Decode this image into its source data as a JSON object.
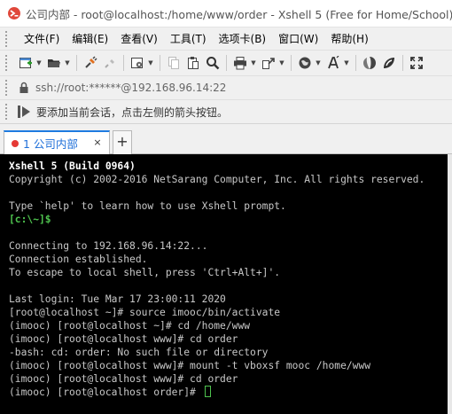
{
  "window": {
    "title": "公司内部 - root@localhost:/home/www/order - Xshell 5 (Free for Home/School)"
  },
  "menu": {
    "items": [
      "文件(F)",
      "编辑(E)",
      "查看(V)",
      "工具(T)",
      "选项卡(B)",
      "窗口(W)",
      "帮助(H)"
    ]
  },
  "toolbar": {
    "icons": [
      "new-session-icon",
      "open-folder-icon",
      "connect-icon",
      "disconnect-icon",
      "properties-icon",
      "copy-icon",
      "paste-icon",
      "find-icon",
      "print-icon",
      "transfer-icon",
      "globe-icon",
      "font-icon",
      "xftp-icon",
      "xshell-icon",
      "fullscreen-icon"
    ]
  },
  "address": {
    "value": "ssh://root:******@192.168.96.14:22"
  },
  "hint": {
    "text": "要添加当前会话，点击左侧的箭头按钮。"
  },
  "tabs": {
    "active_label": "1 公司内部",
    "close_glyph": "×",
    "new_glyph": "+"
  },
  "terminal": {
    "lines": [
      "Xshell 5 (Build 0964)",
      "Copyright (c) 2002-2016 NetSarang Computer, Inc. All rights reserved.",
      "",
      "Type `help' to learn how to use Xshell prompt.",
      "[c:\\~]$",
      "",
      "Connecting to 192.168.96.14:22...",
      "Connection established.",
      "To escape to local shell, press 'Ctrl+Alt+]'.",
      "",
      "Last login: Tue Mar 17 23:00:11 2020",
      "[root@localhost ~]# source imooc/bin/activate",
      "(imooc) [root@localhost ~]# cd /home/www",
      "(imooc) [root@localhost www]# cd order",
      "-bash: cd: order: No such file or directory",
      "(imooc) [root@localhost www]# mount -t vboxsf mooc /home/www",
      "(imooc) [root@localhost www]# cd order",
      "(imooc) [root@localhost order]# "
    ],
    "bold_lines": [
      0
    ],
    "green_lines": [
      4
    ]
  },
  "colors": {
    "terminal_bg": "#000000",
    "terminal_fg": "#c8c8c8",
    "prompt_green": "#4ec24e",
    "tab_accent": "#1e7be0",
    "tab_text": "#1e6fd9"
  }
}
